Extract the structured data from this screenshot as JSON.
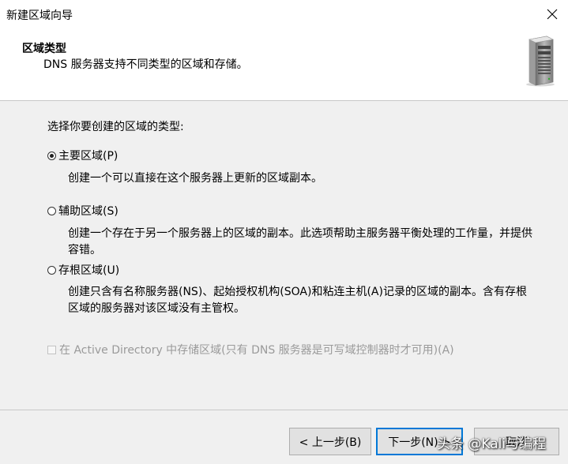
{
  "window": {
    "title": "新建区域向导"
  },
  "header": {
    "title": "区域类型",
    "subtitle": "DNS 服务器支持不同类型的区域和存储。"
  },
  "body": {
    "prompt": "选择你要创建的区域的类型:",
    "options": [
      {
        "label": "主要区域(P)",
        "checked": true,
        "description": "创建一个可以直接在这个服务器上更新的区域副本。"
      },
      {
        "label": "辅助区域(S)",
        "checked": false,
        "description": "创建一个存在于另一个服务器上的区域的副本。此选项帮助主服务器平衡处理的工作量，并提供容错。"
      },
      {
        "label": "存根区域(U)",
        "checked": false,
        "description": "创建只含有名称服务器(NS)、起始授权机构(SOA)和粘连主机(A)记录的区域的副本。含有存根区域的服务器对该区域没有主管权。"
      }
    ],
    "ad_checkbox": {
      "label": "在 Active Directory 中存储区域(只有 DNS 服务器是可写域控制器时才可用)(A)",
      "checked": false,
      "enabled": false
    }
  },
  "footer": {
    "back_label": "< 上一步(B)",
    "next_label": "下一步(N) >",
    "cancel_label": "取消"
  },
  "watermark": "头条 @Kali与编程"
}
